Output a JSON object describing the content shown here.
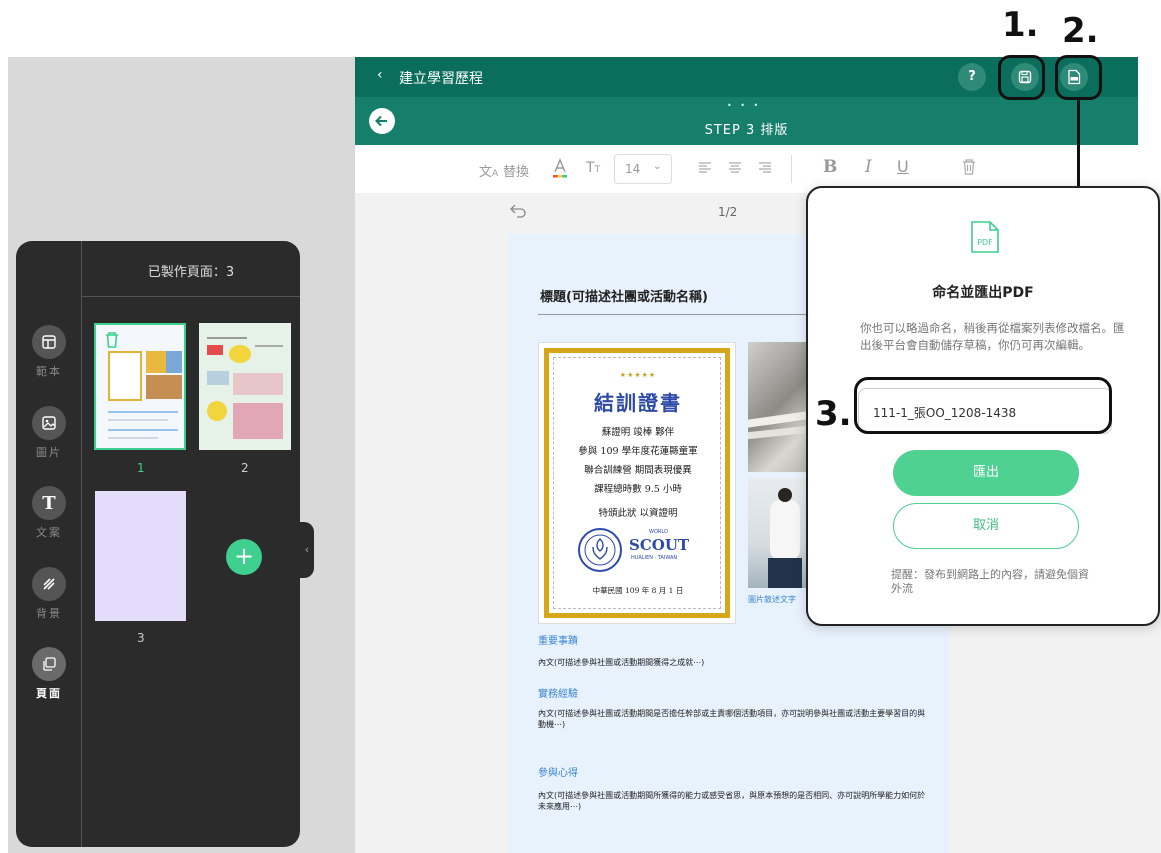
{
  "header": {
    "back_label": "建立學習歷程",
    "help_label": "?"
  },
  "step": {
    "title": "STEP 3 排版"
  },
  "toolbar": {
    "replace_label": "替換",
    "font_size": "14"
  },
  "canvas": {
    "page_indicator": "1/2"
  },
  "pages_panel": {
    "title": "已製作頁面：3",
    "rail": [
      {
        "label": "範本"
      },
      {
        "label": "圖片"
      },
      {
        "label": "文案"
      },
      {
        "label": "背景"
      },
      {
        "label": "頁面"
      }
    ],
    "thumbnails": [
      {
        "number": "1"
      },
      {
        "number": "2"
      },
      {
        "number": "3"
      }
    ]
  },
  "document": {
    "heading": "標題(可描述社團或活動名稱)",
    "certificate": {
      "stars": "★★★★★",
      "title": "結訓證書",
      "lines": [
        "蘇證明 竣棒 夥伴",
        "參與 109 學年度花蓮縣童軍",
        "聯合訓練營 期間表現優異",
        "課程總時數 9.5 小時",
        "特頒此狀 以資證明"
      ],
      "logo_world": "WORLD",
      "logo_scout": "SCOUT",
      "logo_sub": "HUALIEN · TAIWAN",
      "date": "中華民國 109 年 8 月 1 日"
    },
    "photo_caption": "圖片敘述文字",
    "sections": [
      {
        "title": "重要事蹟",
        "body": "內文(可描述參與社團或活動期間獲得之成就⋯)"
      },
      {
        "title": "實務經驗",
        "body": "內文(可描述參與社團或活動期間是否擔任幹部或主責哪個活動項目，亦可說明參與社團或活動主要學習目的與動機⋯)"
      },
      {
        "title": "參與心得",
        "body": "內文(可描述參與社團或活動期間所獲得的能力或感受省思，與原本預想的是否相同、亦可說明所學能力如何於未來應用⋯)"
      }
    ]
  },
  "dialog": {
    "icon_text": "PDF",
    "title": "命名並匯出PDF",
    "description": "你也可以略過命名，稍後再從檔案列表修改檔名。匯出後平台會自動儲存草稿，你仍可再次編輯。",
    "filename_value": "111-1_張OO_1208-1438",
    "export_label": "匯出",
    "cancel_label": "取消",
    "tip": "提醒：發布到網路上的內容，請避免個資外流"
  },
  "annotations": {
    "one": "1.",
    "two": "2.",
    "three": "3."
  },
  "colors": {
    "brand_dark": "#0b6e5c",
    "brand": "#157f6b",
    "accent": "#3fcf8e",
    "panel": "#2b2b2b"
  }
}
